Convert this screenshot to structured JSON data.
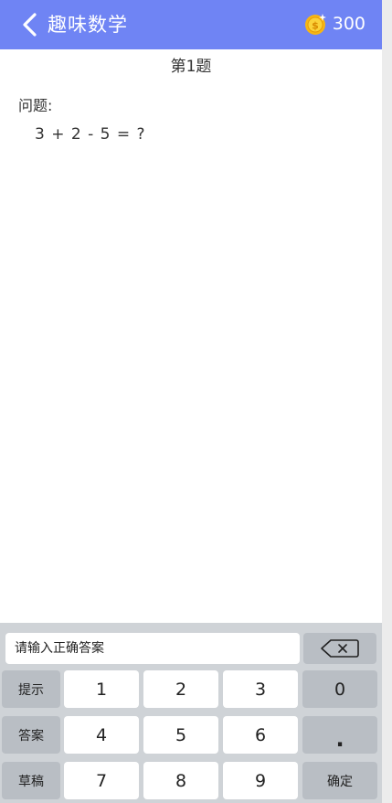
{
  "header": {
    "title": "趣味数学",
    "coins": "300",
    "back_icon": "chevron-left-icon",
    "coin_icon": "coin-icon"
  },
  "question": {
    "title": "第1题",
    "label": "问题:",
    "text": "3 + 2 - 5 = ?"
  },
  "keyboard": {
    "input_placeholder": "请输入正确答案",
    "input_value": "",
    "side_keys": [
      "提示",
      "答案",
      "草稿"
    ],
    "digits_row1": [
      "1",
      "2",
      "3"
    ],
    "digits_row2": [
      "4",
      "5",
      "6"
    ],
    "digits_row3": [
      "7",
      "8",
      "9"
    ],
    "zero": "0",
    "dot": ".",
    "confirm": "确定",
    "backspace_icon": "backspace-icon"
  },
  "colors": {
    "header_bg": "#6f84f4",
    "keyboard_bg": "#cfd3d7",
    "function_key": "#b9bec4",
    "coin": "#f7b613"
  }
}
